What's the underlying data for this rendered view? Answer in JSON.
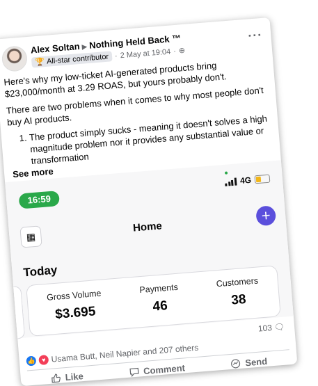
{
  "post": {
    "author": "Alex Soltan",
    "group": "Nothing Held Back ™",
    "badge": "All-star contributor",
    "timestamp": "2 May at 19:04",
    "paragraph1": "Here's why my low-ticket AI-generated products bring $23,000/month at 3.29 ROAS, but yours probably don't.",
    "paragraph2": "There are two problems when it comes to why most people don't buy AI products.",
    "list_item1": "The product simply sucks - meaning it doesn't solves a high magnitude problem nor it provides any substantial value or transformation",
    "see_more": "See more"
  },
  "phone": {
    "time": "16:59",
    "network": "4G",
    "title": "Home",
    "section": "Today",
    "stats": [
      {
        "label": "Gross Volume",
        "value": "$3.695"
      },
      {
        "label": "Payments",
        "value": "46"
      },
      {
        "label": "Customers",
        "value": "38"
      }
    ]
  },
  "engagement": {
    "comments_count": "103",
    "reactions_text": "Usama Butt, Neil Napier and 207 others",
    "like_color": "#1877f2",
    "love_color": "#f33e58"
  },
  "actions": {
    "like": "Like",
    "comment": "Comment",
    "send": "Send"
  }
}
